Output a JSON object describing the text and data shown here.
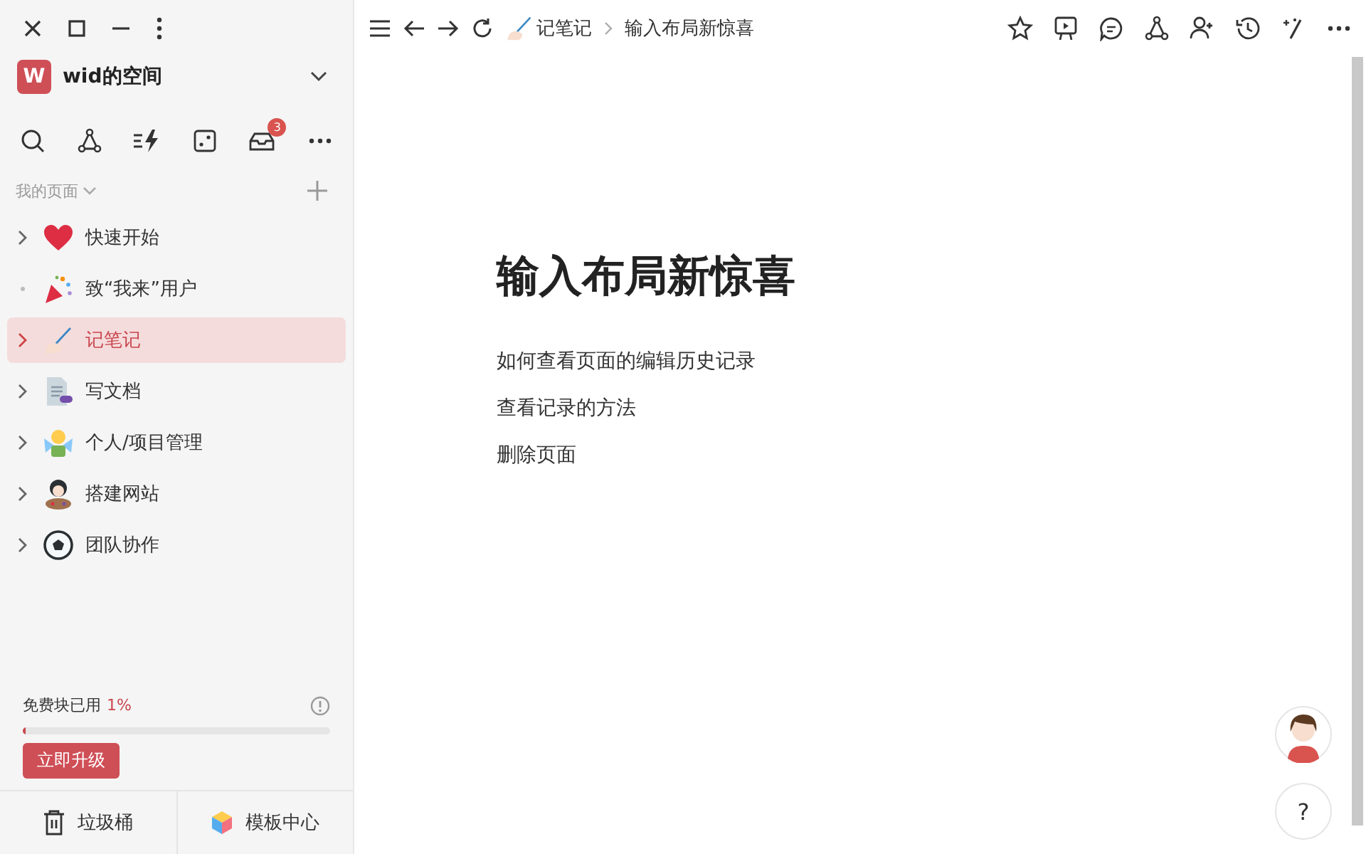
{
  "workspace": {
    "initial": "W",
    "name": "wid的空间"
  },
  "inbox_badge": "3",
  "section": {
    "title": "我的页面"
  },
  "pages": [
    {
      "title": "快速开始",
      "kind": "heart",
      "has_children": true,
      "selected": false
    },
    {
      "title": "致“我来”用户",
      "kind": "party",
      "has_children": false,
      "selected": false
    },
    {
      "title": "记笔记",
      "kind": "pen",
      "has_children": true,
      "selected": true
    },
    {
      "title": "写文档",
      "kind": "doc",
      "has_children": true,
      "selected": false
    },
    {
      "title": "个人/项目管理",
      "kind": "fairy",
      "has_children": true,
      "selected": false
    },
    {
      "title": "搭建网站",
      "kind": "artist",
      "has_children": true,
      "selected": false
    },
    {
      "title": "团队协作",
      "kind": "ball",
      "has_children": true,
      "selected": false
    }
  ],
  "usage": {
    "label": "免费块已用",
    "percent": "1%",
    "level": 0.01
  },
  "upgrade_button": "立即升级",
  "footer": [
    {
      "kind": "trash",
      "label": "垃圾桶"
    },
    {
      "kind": "template",
      "label": "模板中心"
    }
  ],
  "breadcrumb": [
    {
      "kind": "pen",
      "label": "记笔记"
    },
    {
      "label": "输入布局新惊喜"
    }
  ],
  "page": {
    "title": "输入布局新惊喜",
    "links": [
      "如何查看页面的编辑历史记录",
      "查看记录的方法",
      "删除页面"
    ]
  },
  "help_button": "?"
}
